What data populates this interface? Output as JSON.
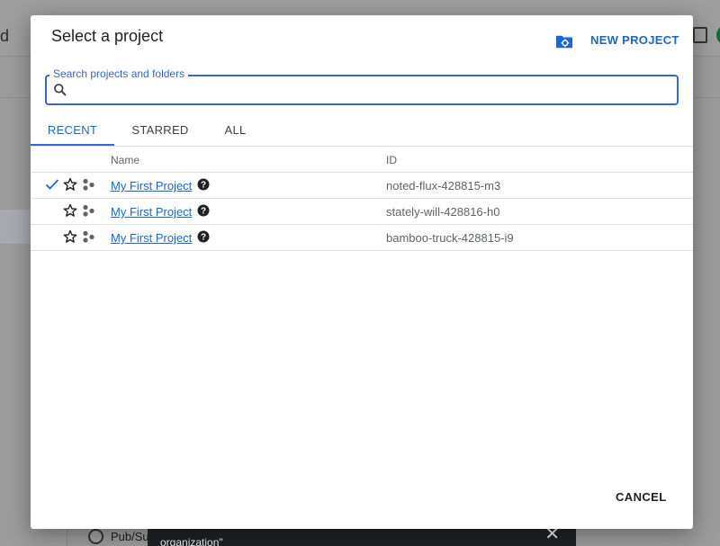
{
  "background": {
    "left_fragment": "d",
    "radio_label": "Pub/Sub",
    "snackbar_text": "organization\"",
    "snackbar_close": "✕"
  },
  "dialog": {
    "title": "Select a project",
    "new_project_label": "NEW PROJECT",
    "search": {
      "label": "Search projects and folders",
      "value": "",
      "placeholder": ""
    },
    "tabs": [
      {
        "label": "RECENT",
        "active": true
      },
      {
        "label": "STARRED",
        "active": false
      },
      {
        "label": "ALL",
        "active": false
      }
    ],
    "table": {
      "columns": [
        "Name",
        "ID"
      ],
      "rows": [
        {
          "name": "My First Project",
          "id": "noted-flux-428815-m3",
          "selected": true
        },
        {
          "name": "My First Project",
          "id": "stately-will-428816-h0",
          "selected": false
        },
        {
          "name": "My First Project",
          "id": "bamboo-truck-428815-i9",
          "selected": false
        }
      ]
    },
    "cancel_label": "CANCEL"
  },
  "colors": {
    "accent": "#1967d2",
    "focus_border": "#3367d6",
    "snackbar_bg": "#202124"
  },
  "icons": {
    "new_project": "folder-gear-icon",
    "search": "search-icon",
    "check": "check-icon",
    "star": "star-outline-icon",
    "type": "project-type-icon",
    "help": "help-circle-icon",
    "close": "close-icon"
  }
}
